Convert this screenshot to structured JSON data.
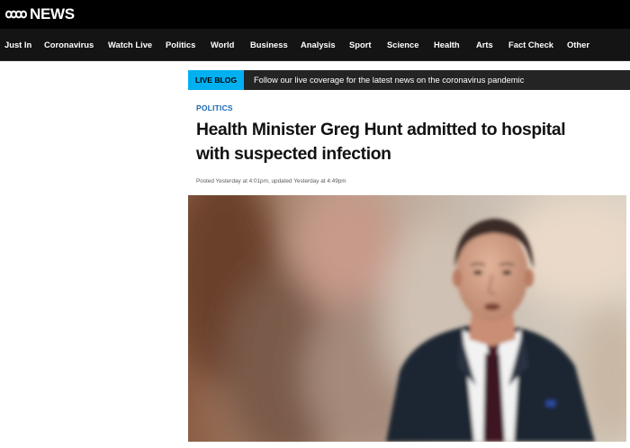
{
  "header": {
    "logo_text": "NEWS",
    "logo_icon": "abc-wave-logo"
  },
  "nav": {
    "items": [
      {
        "label": "Just In"
      },
      {
        "label": "Coronavirus"
      },
      {
        "label": "Watch Live"
      },
      {
        "label": "Politics"
      },
      {
        "label": "World"
      },
      {
        "label": "Business"
      },
      {
        "label": "Analysis"
      },
      {
        "label": "Sport"
      },
      {
        "label": "Science"
      },
      {
        "label": "Health"
      },
      {
        "label": "Arts"
      },
      {
        "label": "Fact Check"
      },
      {
        "label": "Other"
      }
    ]
  },
  "live_blog": {
    "badge": "LIVE BLOG",
    "text": "Follow our live coverage for the latest news on the coronavirus pandemic",
    "badge_color": "#00b0f0"
  },
  "article": {
    "category": "POLITICS",
    "headline_line1": "Health Minister Greg Hunt admitted to hospital",
    "headline_line2": "with suspected infection",
    "dateline": "Posted Yesterday at 4:01pm, updated Yesterday at 4:49pm",
    "category_color": "#1a67b5",
    "hero_image": "photo-of-man-in-suit"
  }
}
